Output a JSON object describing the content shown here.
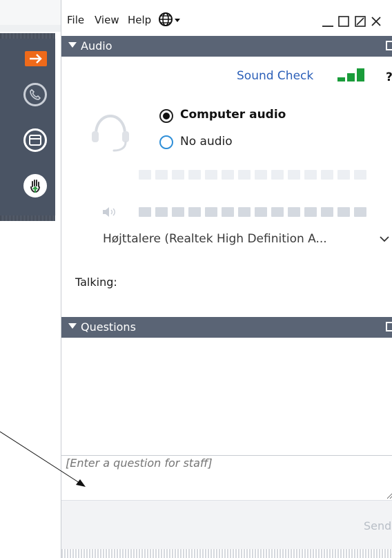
{
  "menu": {
    "file": "File",
    "view": "View",
    "help": "Help"
  },
  "icons": {
    "globe": "globe-icon",
    "minimize": "minimize-icon",
    "maximize": "maximize-icon",
    "restore": "restore-icon",
    "close": "close-icon",
    "headset": "headset-icon",
    "speaker": "speaker-icon",
    "signal": "signal-bars-icon",
    "help": "help-icon"
  },
  "audio": {
    "header": "Audio",
    "sound_check": "Sound Check",
    "help_mark": "?",
    "options": {
      "computer": "Computer audio",
      "none": "No audio"
    },
    "selected": "Computer audio",
    "speaker_device": "Højttalere (Realtek High Definition A...",
    "talking_label": "Talking:"
  },
  "questions": {
    "header": "Questions",
    "input_placeholder": "[Enter a question for staff]",
    "send_label": "Send"
  },
  "colors": {
    "header_bg": "#5a6475",
    "toolbar_bg": "#4a5464",
    "accent_orange": "#ef6a1a",
    "link_blue": "#2b5fb8",
    "signal_green": "#1a9c3a",
    "hand_green": "#2f9e44"
  }
}
